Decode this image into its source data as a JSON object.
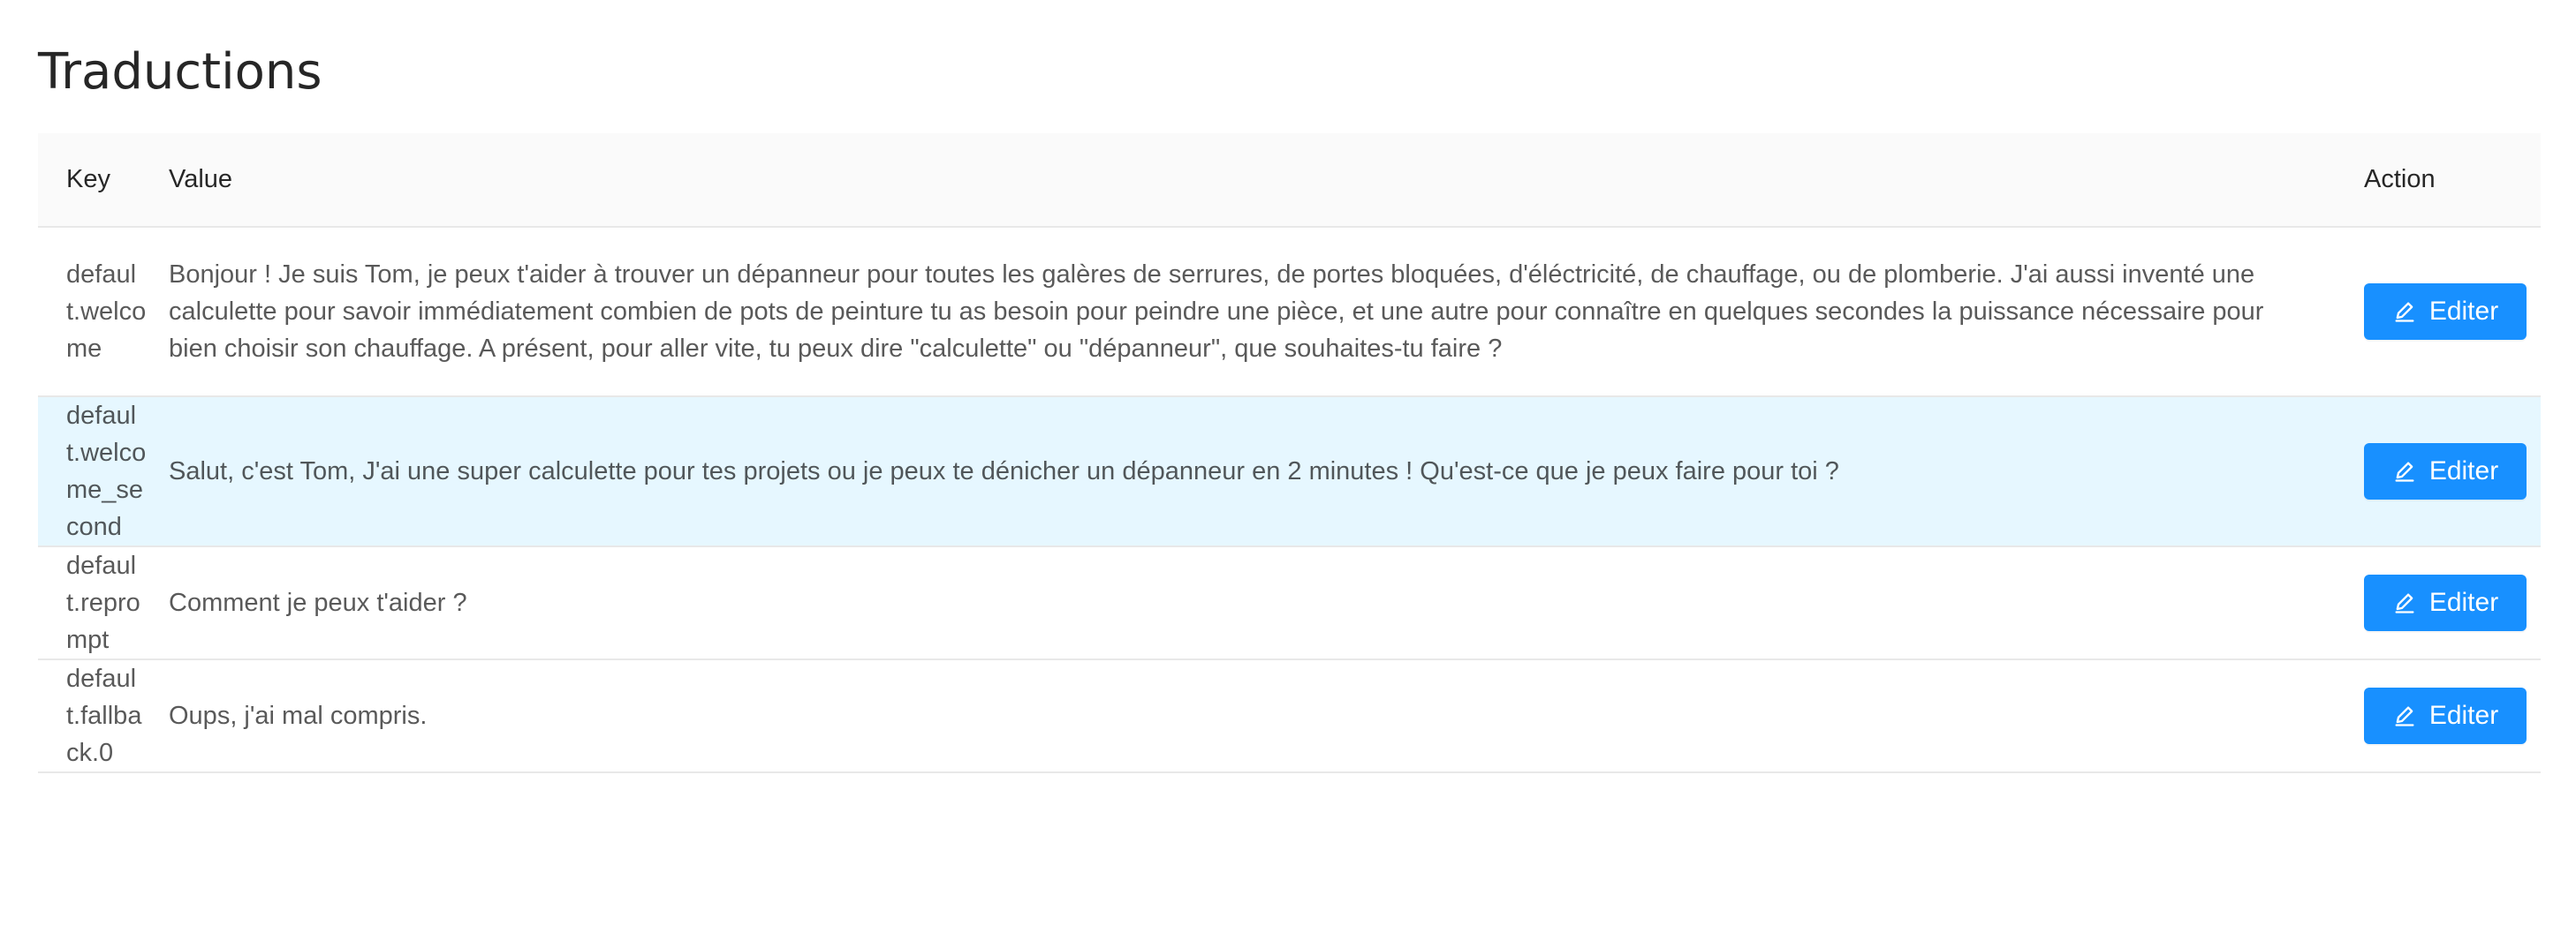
{
  "page": {
    "title": "Traductions"
  },
  "table": {
    "columns": {
      "key": "Key",
      "value": "Value",
      "action": "Action"
    },
    "rows": [
      {
        "key": "default.welcome",
        "value": "Bonjour ! Je suis Tom, je peux t'aider à trouver un dépanneur pour toutes les galères de serrures, de portes bloquées, d'éléctricité, de chauffage, ou de plomberie. J'ai aussi inventé une calculette pour savoir immédiatement combien de pots de peinture tu as besoin pour peindre une pièce, et une autre pour connaître en quelques secondes la puissance nécessaire pour bien choisir son chauffage. A présent, pour aller vite, tu peux dire \"calculette\" ou \"dépanneur\", que souhaites-tu faire ?",
        "action_label": "Editer",
        "action_icon": "edit-icon"
      },
      {
        "key": "default.welcome_second",
        "value": "Salut, c'est Tom, J'ai une super calculette pour tes projets ou je peux te dénicher un dépanneur en 2 minutes ! Qu'est-ce que je peux faire pour toi ?",
        "action_label": "Editer",
        "action_icon": "edit-icon"
      },
      {
        "key": "default.reprompt",
        "value": "Comment je peux t'aider ?",
        "action_label": "Editer",
        "action_icon": "edit-icon"
      },
      {
        "key": "default.fallback.0",
        "value": "Oups, j'ai mal compris.",
        "action_label": "Editer",
        "action_icon": "edit-icon"
      }
    ]
  },
  "colors": {
    "primary": "#1890ff",
    "row_highlight": "#e6f7ff",
    "header_bg": "#fafafa",
    "border": "#e8e8e8"
  }
}
